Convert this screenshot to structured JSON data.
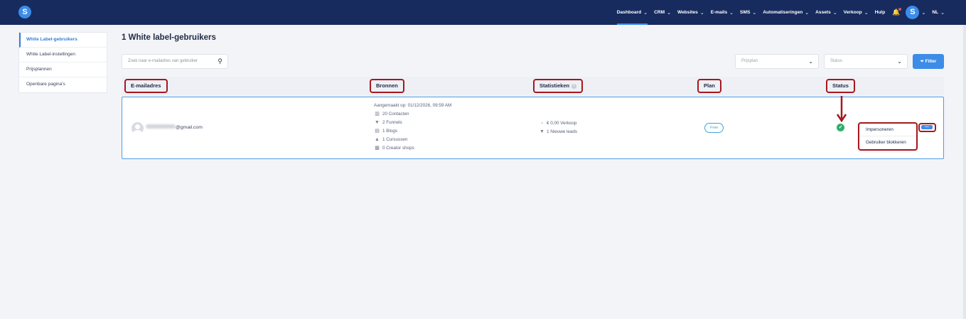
{
  "app": {
    "logo_letter": "S",
    "nav": [
      {
        "label": "Dashboard",
        "active": true
      },
      {
        "label": "CRM"
      },
      {
        "label": "Websites"
      },
      {
        "label": "E-mails"
      },
      {
        "label": "SMS"
      },
      {
        "label": "Automatiseringen"
      },
      {
        "label": "Assets"
      },
      {
        "label": "Verkoop"
      },
      {
        "label": "Hulp"
      }
    ],
    "avatar_letter": "S",
    "language": "NL"
  },
  "sidebar": {
    "items": [
      {
        "label": "White Label-gebruikers",
        "active": true
      },
      {
        "label": "White Label-instellingen"
      },
      {
        "label": "Prijsplannen"
      },
      {
        "label": "Openbare pagina's"
      }
    ]
  },
  "main": {
    "title": "1 White label-gebruikers",
    "search_placeholder": "Zoek naar e-mailadres van gebruiker",
    "filter_plan_placeholder": "Prijsplan",
    "filter_status_placeholder": "Status",
    "filter_button": "Filter",
    "columns": {
      "email": "E-mailadres",
      "sources": "Bronnen",
      "stats": "Statistieken",
      "plan": "Plan",
      "status": "Status"
    },
    "row": {
      "email_suffix": "@gmail.com",
      "created": "Aangemaakt op: 01/12/2026, 09:59 AM",
      "sources": [
        {
          "icon": "contacts-icon",
          "label": "20 Contacten"
        },
        {
          "icon": "funnel-icon",
          "label": "2 Funnels"
        },
        {
          "icon": "blog-icon",
          "label": "1 Blogs"
        },
        {
          "icon": "course-icon",
          "label": "1 Cursussen"
        },
        {
          "icon": "shop-icon",
          "label": "0 Creator shops"
        }
      ],
      "stats": [
        {
          "icon": "money-icon",
          "label": "€ 0,00 Verkoop"
        },
        {
          "icon": "funnel-icon",
          "label": "1 Nieuwe leads"
        }
      ],
      "plan": "Free",
      "status": "active"
    },
    "actions_menu": {
      "items": [
        "Impersoneren",
        "Gebruiker blokkeren"
      ]
    }
  },
  "colors": {
    "topbar": "#172b5e",
    "accent": "#3d8ce8",
    "highlight": "#a4191f",
    "success": "#2fae6a"
  }
}
